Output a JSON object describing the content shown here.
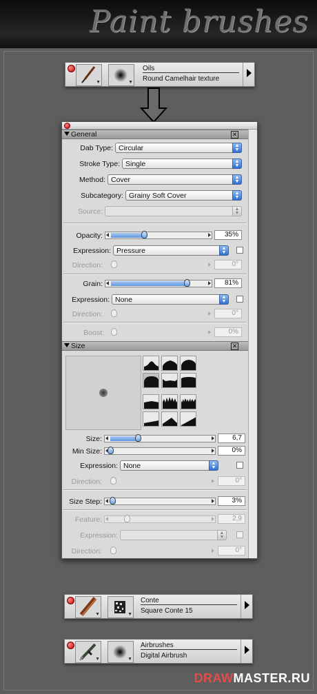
{
  "header": {
    "title": "Paint brushes"
  },
  "brush_bars": [
    {
      "category": "Oils",
      "variant": "Round Camelhair texture",
      "icon": "paintbrush-icon"
    },
    {
      "category": "Conte",
      "variant": "Square Conte 15",
      "icon": "conte-stick-icon"
    },
    {
      "category": "Airbrushes",
      "variant": "Digital Airbrush",
      "icon": "airbrush-icon"
    }
  ],
  "general": {
    "section_label": "General",
    "dab_type": {
      "label": "Dab Type:",
      "value": "Circular"
    },
    "stroke_type": {
      "label": "Stroke Type:",
      "value": "Single"
    },
    "method": {
      "label": "Method:",
      "value": "Cover"
    },
    "subcategory": {
      "label": "Subcategory:",
      "value": "Grainy Soft Cover"
    },
    "source": {
      "label": "Source:",
      "value": ""
    },
    "opacity": {
      "label": "Opacity:",
      "value": "35%",
      "level": 0.35
    },
    "opacity_expression": {
      "label": "Expression:",
      "value": "Pressure"
    },
    "opacity_direction": {
      "label": "Direction:",
      "value": "0°"
    },
    "grain": {
      "label": "Grain:",
      "value": "81%",
      "level": 0.81
    },
    "grain_expression": {
      "label": "Expression:",
      "value": "None"
    },
    "grain_direction": {
      "label": "Direction:",
      "value": "0°"
    },
    "boost": {
      "label": "Boost:",
      "value": "0%"
    }
  },
  "size": {
    "section_label": "Size",
    "size": {
      "label": "Size:",
      "value": "6,7"
    },
    "min_size": {
      "label": "Min Size:",
      "value": "0%"
    },
    "expression": {
      "label": "Expression:",
      "value": "None"
    },
    "direction": {
      "label": "Direction:",
      "value": "0°"
    },
    "size_step": {
      "label": "Size Step:",
      "value": "3%"
    },
    "feature": {
      "label": "Feature:",
      "value": "2,9"
    },
    "feature_expression": {
      "label": "Expression:",
      "value": ""
    },
    "feature_direction": {
      "label": "Direction:",
      "value": "0°"
    }
  },
  "watermark": {
    "part1": "DRAW",
    "part2": "MASTER.RU"
  }
}
